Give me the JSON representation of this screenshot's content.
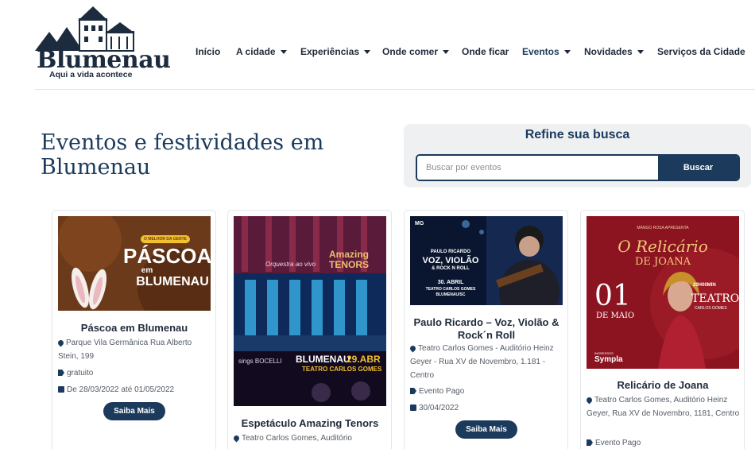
{
  "logo": {
    "name": "Blumenau",
    "tagline": "Aqui a vida acontece"
  },
  "nav": {
    "items": [
      {
        "label": "Início",
        "dropdown": false
      },
      {
        "label": "A cidade",
        "dropdown": true
      },
      {
        "label": "Experiências",
        "dropdown": true
      },
      {
        "label": "Onde comer",
        "dropdown": true
      },
      {
        "label": "Onde ficar",
        "dropdown": false
      },
      {
        "label": "Eventos",
        "dropdown": true
      },
      {
        "label": "Novidades",
        "dropdown": true
      },
      {
        "label": "Serviços da Cidade",
        "dropdown": false
      }
    ]
  },
  "page": {
    "title": "Eventos e festividades em Blumenau"
  },
  "refine": {
    "title": "Refine sua busca",
    "placeholder": "Buscar por eventos",
    "button": "Buscar"
  },
  "cards": [
    {
      "title": "Páscoa em Blumenau",
      "location": "Parque Vila Germânica Rua Alberto Stein, 199",
      "tag": "gratuito",
      "date": "De 28/03/2022 até 01/05/2022",
      "button": "Saiba Mais",
      "image_text": {
        "badge": "O MELHOR DA GENTE",
        "line1": "PÁSCOA",
        "line2": "em",
        "line3": "BLUMENAU"
      }
    },
    {
      "title": "Espetáculo Amazing Tenors",
      "location": "Teatro Carlos Gomes, Auditório",
      "image_text": {
        "line1": "Orquestra ao vivo",
        "brand": "Amazing TENORS",
        "line2": "sings BOCELLI",
        "city": "BLUMENAU",
        "date": "29.ABR",
        "venue": "TEATRO CARLOS GOMES"
      }
    },
    {
      "title": "Paulo Ricardo – Voz, Violão & Rock´n Roll",
      "location": "Teatro Carlos Gomes - Auditório Heinz Geyer - Rua XV de Novembro, 1.181 - Centro",
      "tag": "Evento Pago",
      "date": "30/04/2022",
      "button": "Saiba Mais",
      "image_text": {
        "brand": "MG",
        "line1": "PAULO RICARDO",
        "line2": "VOZ, VIOLÃO",
        "line3": "& ROCK N ROLL",
        "date": "30. ABRIL",
        "venue": "TEATRO CARLOS GOMES",
        "city": "BLUMENAU/SC"
      }
    },
    {
      "title": "Relicário de Joana",
      "location": "Teatro Carlos Gomes, Auditório Heinz Geyer, Rua XV de Novembro, 1181, Centro",
      "tag": "Evento Pago",
      "image_text": {
        "top": "MANGO ROSA APRESENTA",
        "line1": "O Relicário",
        "line2": "DE JOANA",
        "day": "01",
        "month": "DE MAIO",
        "time": "20H00MIN",
        "venue": "TEATRO",
        "venue2": "CARLOS GOMES",
        "tickets": "INGRESSOS",
        "seller": "Sympla"
      }
    }
  ]
}
